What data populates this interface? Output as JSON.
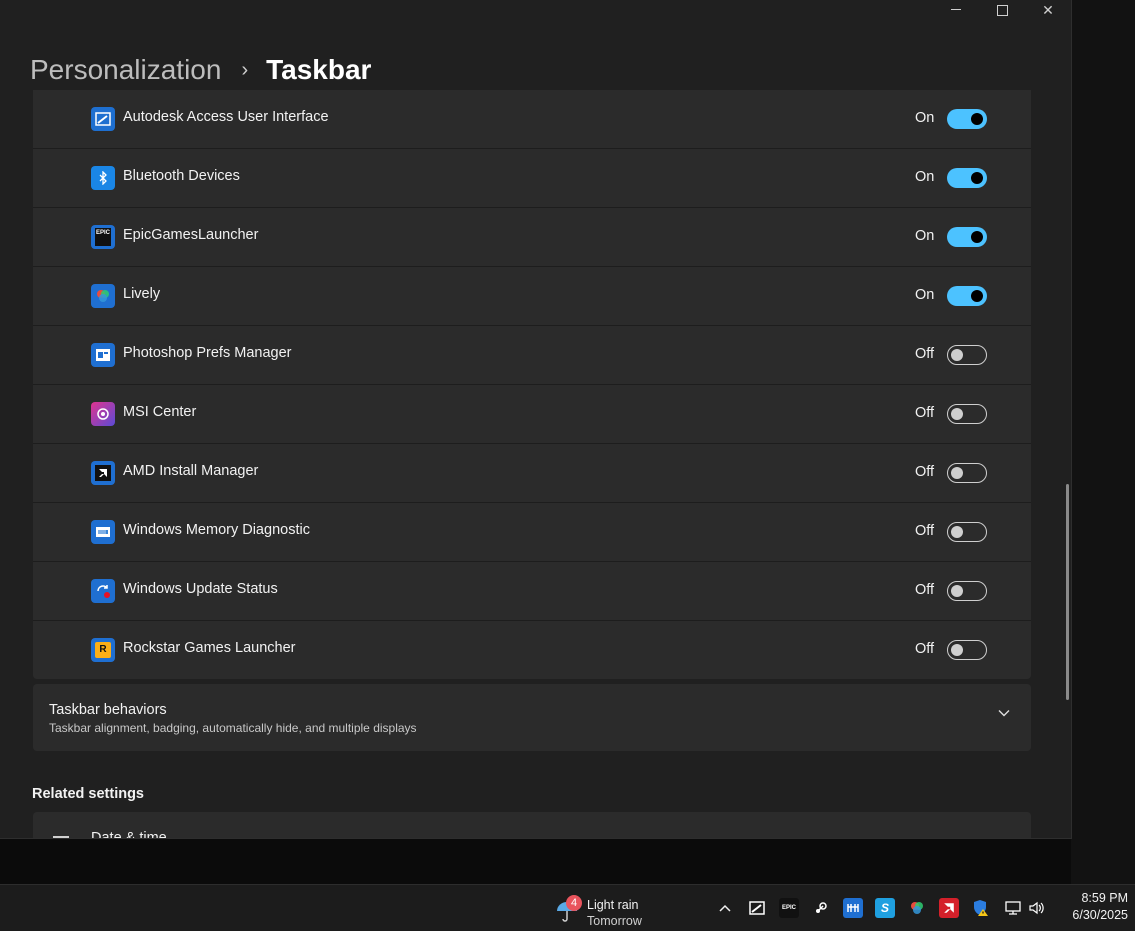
{
  "window": {
    "breadcrumb_parent": "Personalization",
    "breadcrumb_current": "Taskbar"
  },
  "apps": [
    {
      "name": "Autodesk Access User Interface",
      "state": "On",
      "enabled": true,
      "icon": "autodesk-icon"
    },
    {
      "name": "Bluetooth Devices",
      "state": "On",
      "enabled": true,
      "icon": "bluetooth-icon"
    },
    {
      "name": "EpicGamesLauncher",
      "state": "On",
      "enabled": true,
      "icon": "epic-games-icon"
    },
    {
      "name": "Lively",
      "state": "On",
      "enabled": true,
      "icon": "lively-icon"
    },
    {
      "name": "Photoshop Prefs Manager",
      "state": "Off",
      "enabled": false,
      "icon": "photoshop-prefs-icon"
    },
    {
      "name": "MSI Center",
      "state": "Off",
      "enabled": false,
      "icon": "msi-center-icon"
    },
    {
      "name": "AMD Install Manager",
      "state": "Off",
      "enabled": false,
      "icon": "amd-icon"
    },
    {
      "name": "Windows Memory Diagnostic",
      "state": "Off",
      "enabled": false,
      "icon": "memory-diagnostic-icon"
    },
    {
      "name": "Windows Update Status",
      "state": "Off",
      "enabled": false,
      "icon": "windows-update-icon"
    },
    {
      "name": "Rockstar Games Launcher",
      "state": "Off",
      "enabled": false,
      "icon": "rockstar-icon"
    }
  ],
  "behaviors": {
    "title": "Taskbar behaviors",
    "subtitle": "Taskbar alignment, badging, automatically hide, and multiple displays"
  },
  "related": {
    "heading": "Related settings",
    "first_item": "Date & time"
  },
  "taskbar": {
    "weather_badge": "4",
    "weather_line1": "Light rain",
    "weather_line2": "Tomorrow",
    "time": "8:59 PM",
    "date": "6/30/2025"
  },
  "colors": {
    "accent": "#4cc2ff",
    "window_bg": "#202020",
    "row_bg": "#2b2b2b"
  }
}
